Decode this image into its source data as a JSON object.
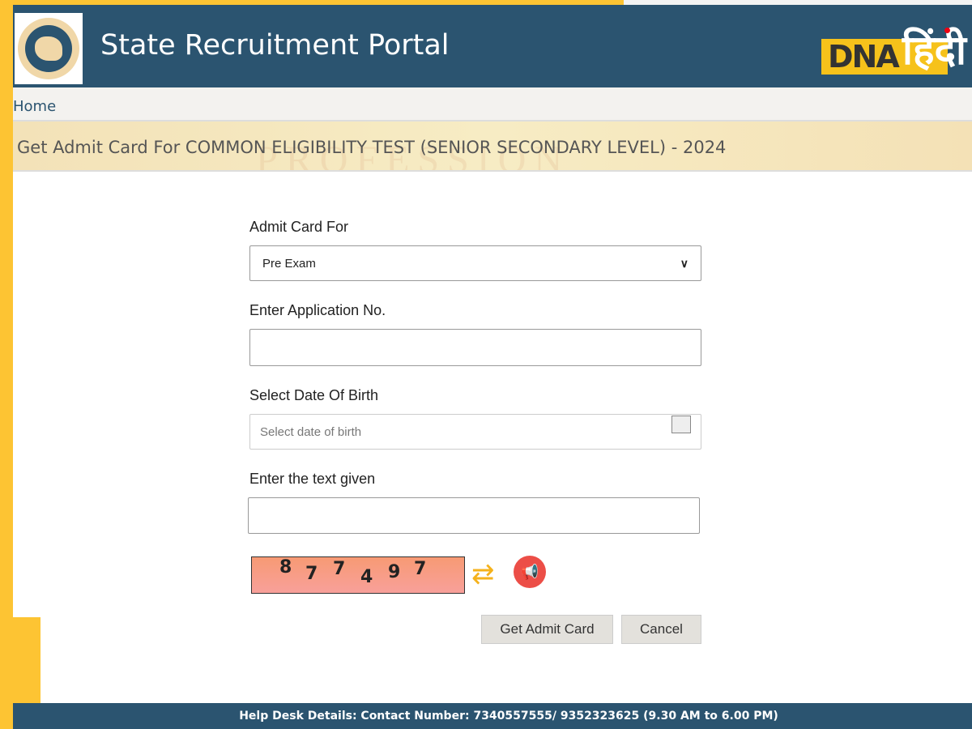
{
  "header": {
    "title": "State Recruitment Portal",
    "watermark_logo": "DNA हिंदी"
  },
  "nav": {
    "home": "Home"
  },
  "banner": {
    "heading": "Get Admit Card For COMMON ELIGIBILITY TEST (SENIOR SECONDARY LEVEL) - 2024"
  },
  "form": {
    "admit_card_for_label": "Admit Card For",
    "admit_card_for_value": "Pre Exam",
    "application_label": "Enter Application No.",
    "application_value": "",
    "dob_label": "Select Date Of Birth",
    "dob_placeholder": "Select date of birth",
    "captcha_label": "Enter the text given",
    "captcha_value": "",
    "captcha_chars": [
      "8",
      "7",
      "7",
      "4",
      "9",
      "7"
    ],
    "submit": "Get Admit Card",
    "cancel": "Cancel"
  },
  "footer": {
    "text": "Help Desk Details: Contact Number: 7340557555/ 9352323625 (9.30 AM to 6.00 PM)"
  },
  "colors": {
    "header": "#2b5470",
    "frame": "#fdc433"
  }
}
